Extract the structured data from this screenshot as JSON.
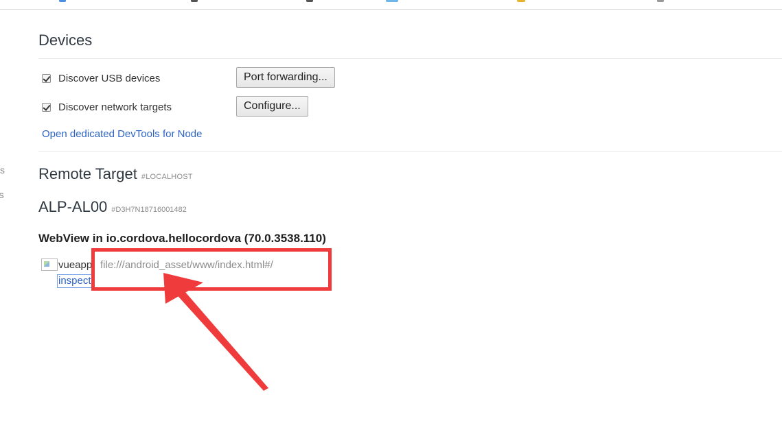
{
  "sidebar_fragments": [
    "s",
    "rs"
  ],
  "devices": {
    "title": "Devices",
    "discover_usb": {
      "label": "Discover USB devices",
      "checked": true
    },
    "discover_network": {
      "label": "Discover network targets",
      "checked": true
    },
    "port_forwarding_button": "Port forwarding...",
    "configure_button": "Configure...",
    "node_link": "Open dedicated DevTools for Node"
  },
  "remote_target": {
    "title": "Remote Target",
    "tag": "#LOCALHOST"
  },
  "device": {
    "name": "ALP-AL00",
    "serial": "#D3H7N18716001482",
    "webview_title": "WebView in io.cordova.hellocordova (70.0.3538.110)",
    "target": {
      "name": "vueapp",
      "url": "file:///android_asset/www/index.html#/",
      "inspect_label": "inspect"
    }
  },
  "annotation": {
    "color": "#ef3b3b"
  }
}
